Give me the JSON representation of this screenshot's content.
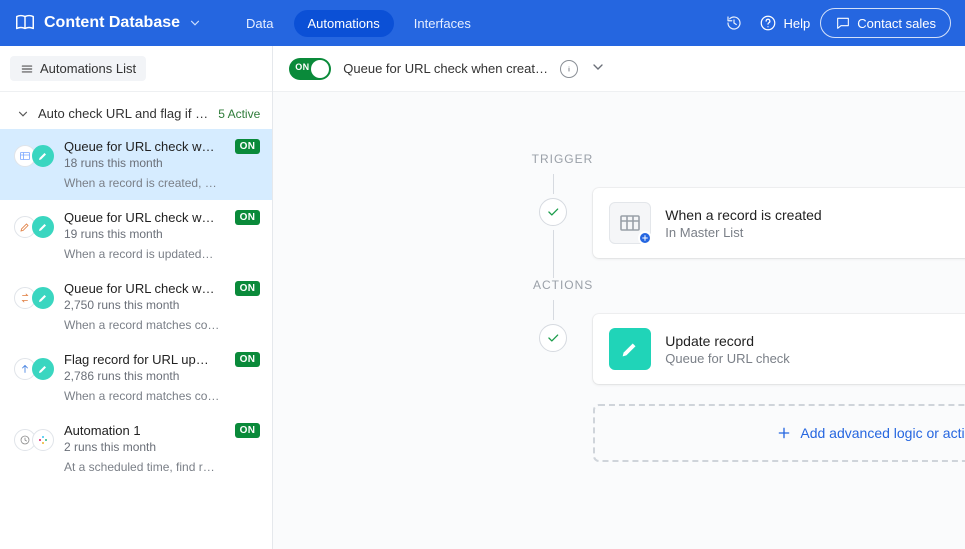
{
  "header": {
    "app_title": "Content Database",
    "tabs": {
      "data": "Data",
      "automations": "Automations",
      "interfaces": "Interfaces"
    },
    "help": "Help",
    "contact": "Contact sales"
  },
  "sidebar": {
    "list_label": "Automations List",
    "group_title": "Auto check URL and flag if re…",
    "group_count": "5 Active",
    "items": [
      {
        "name": "Queue for URL check w…",
        "runs": "18 runs this month",
        "badge": "ON",
        "desc": "When a record is created, …"
      },
      {
        "name": "Queue for URL check w…",
        "runs": "19 runs this month",
        "badge": "ON",
        "desc": "When a record is updated…"
      },
      {
        "name": "Queue for URL check w…",
        "runs": "2,750 runs this month",
        "badge": "ON",
        "desc": "When a record matches co…"
      },
      {
        "name": "Flag record for URL up…",
        "runs": "2,786 runs this month",
        "badge": "ON",
        "desc": "When a record matches co…"
      },
      {
        "name": "Automation 1",
        "runs": "2 runs this month",
        "badge": "ON",
        "desc": "At a scheduled time, find r…"
      }
    ]
  },
  "main": {
    "toggle_label": "ON",
    "title": "Queue for URL check when creat…",
    "sections": {
      "trigger": "TRIGGER",
      "actions": "ACTIONS"
    },
    "trigger_card": {
      "title": "When a record is created",
      "subtitle": "In Master List"
    },
    "action_card": {
      "title": "Update record",
      "subtitle": "Queue for URL check"
    },
    "add_label": "Add advanced logic or action"
  }
}
